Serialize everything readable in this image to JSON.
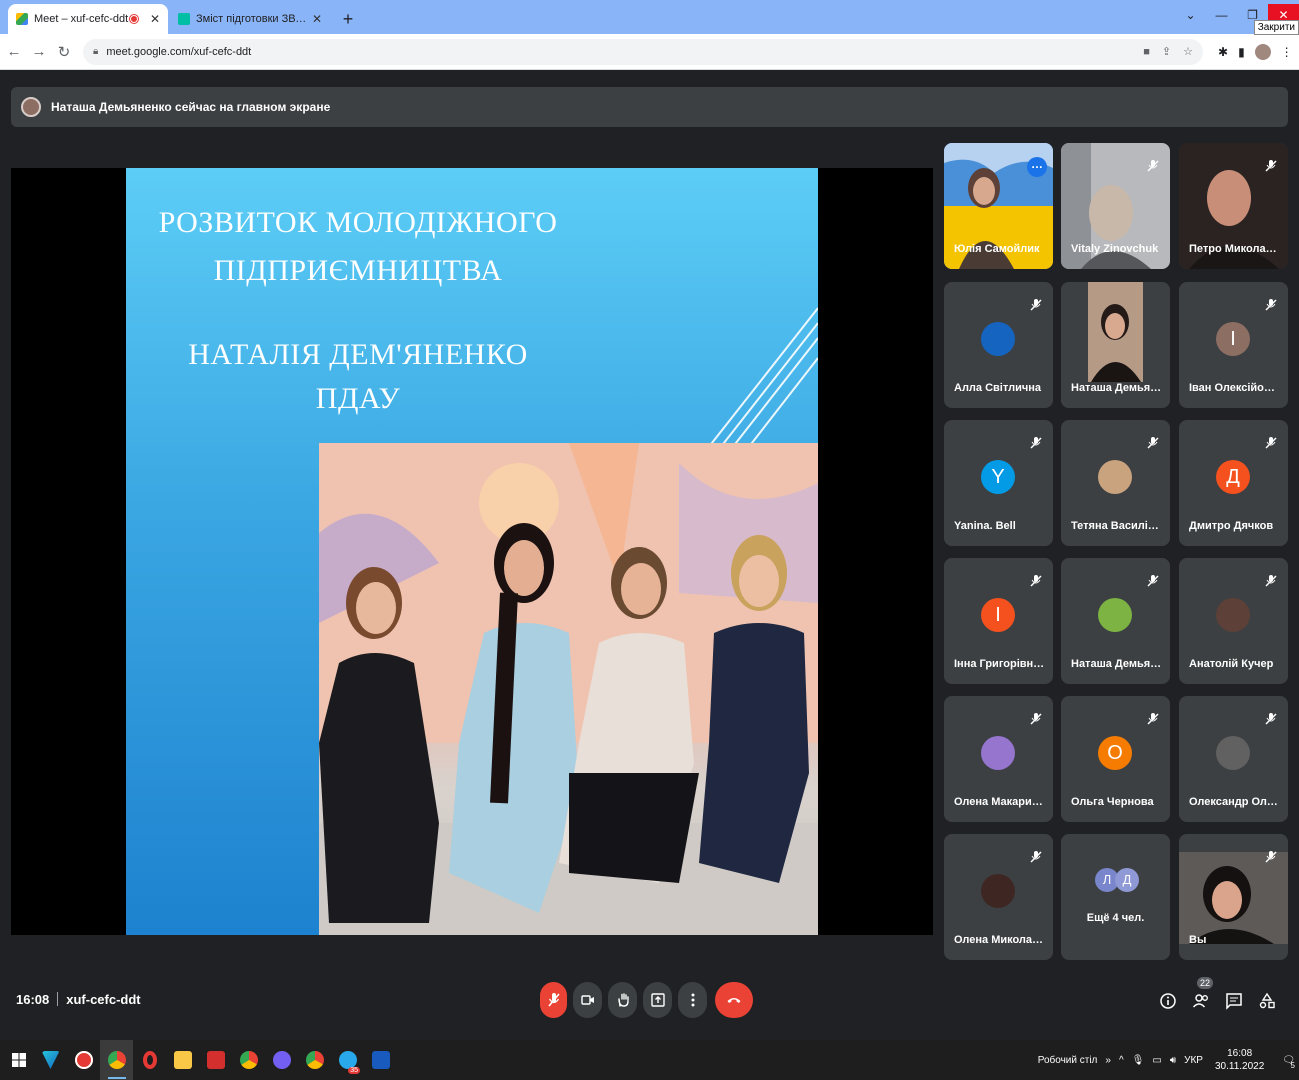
{
  "browser": {
    "tabs": [
      {
        "title": "Meet – xuf-cefc-ddt",
        "favicon_color": "#00897b"
      },
      {
        "title": "Зміст підготовки ЗВО за освітнь...",
        "favicon_color": "#00bfa5"
      }
    ],
    "close_tooltip": "Закрити",
    "url": "meet.google.com/xuf-cefc-ddt"
  },
  "banner": {
    "text": "Наташа Демьяненко сейчас на главном экране"
  },
  "slide": {
    "line1": "РОЗВИТОК МОЛОДІЖНОГО",
    "line2": "ПІДПРИЄМНИЦТВА",
    "line3": "НАТАЛІЯ ДЕМ'ЯНЕНКО",
    "line4": "ПДАУ"
  },
  "participants": [
    {
      "name": "Юлія Самойлик",
      "type": "video",
      "speaking": true,
      "muted": false
    },
    {
      "name": "Vitaly Zinovchuk",
      "type": "video",
      "muted": true
    },
    {
      "name": "Петро Миколайо...",
      "type": "video",
      "muted": true
    },
    {
      "name": "Алла Світлична",
      "type": "photo",
      "color": "#1565c0",
      "muted": true
    },
    {
      "name": "Наташа Демьяне...",
      "type": "video",
      "muted": false
    },
    {
      "name": "Іван Олексійови...",
      "type": "letter",
      "letter": "І",
      "color": "#8d6e63",
      "muted": true
    },
    {
      "name": "Yanina. Bell",
      "type": "letter",
      "letter": "Y",
      "color": "#039be5",
      "muted": true
    },
    {
      "name": "Тетяна Василівна...",
      "type": "photo",
      "color": "#c9a27e",
      "muted": true
    },
    {
      "name": "Дмитро Дячков",
      "type": "letter",
      "letter": "Д",
      "color": "#f4511e",
      "muted": true
    },
    {
      "name": "Інна Григорівна ...",
      "type": "letter",
      "letter": "І",
      "color": "#f4511e",
      "muted": true
    },
    {
      "name": "Наташа Демьяне...",
      "type": "photo",
      "color": "#7cb342",
      "muted": true
    },
    {
      "name": "Анатолій Кучер",
      "type": "photo",
      "color": "#5d4037",
      "muted": true
    },
    {
      "name": "Олена Макаринс...",
      "type": "photo",
      "color": "#9575cd",
      "muted": true
    },
    {
      "name": "Ольга Чернова",
      "type": "letter",
      "letter": "О",
      "color": "#f57c00",
      "muted": true
    },
    {
      "name": "Олександр Олек...",
      "type": "photo",
      "color": "#616161",
      "muted": true
    },
    {
      "name": "Олена Миколаїв...",
      "type": "photo",
      "color": "#3e2723",
      "muted": true
    },
    {
      "name": "Вы",
      "type": "video",
      "muted": true
    }
  ],
  "more_people": {
    "letters": [
      "Л",
      "Д"
    ],
    "label": "Ещё 4 чел."
  },
  "meeting": {
    "time": "16:08",
    "code": "xuf-cefc-ddt",
    "participant_count": "22"
  },
  "taskbar": {
    "desktop_label": "Робочий стіл",
    "lang": "УКР",
    "time": "16:08",
    "date": "30.11.2022",
    "notifications": "5",
    "telegram_badge": "35"
  }
}
